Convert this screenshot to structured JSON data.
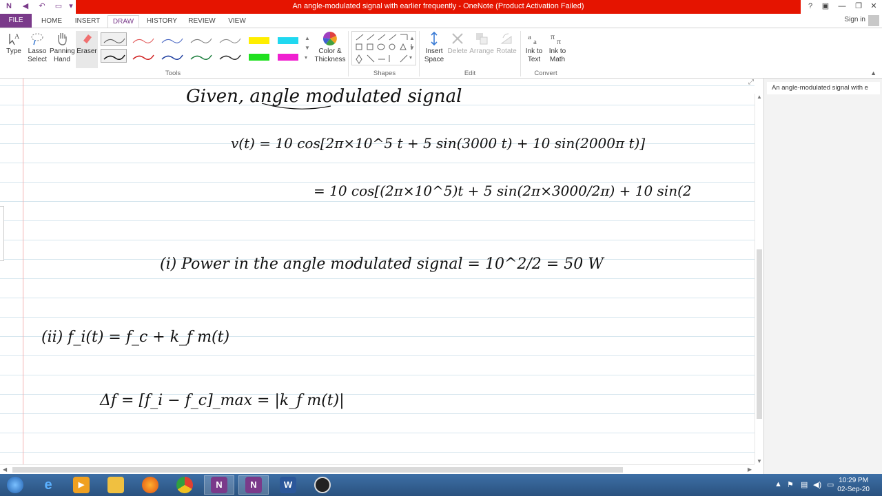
{
  "window": {
    "title": "An angle-modulated signal with earlier frequently  - OneNote (Product Activation Failed)",
    "sign_in": "Sign in",
    "title_color": "#e51400"
  },
  "tabs": [
    {
      "label": "FILE"
    },
    {
      "label": "HOME"
    },
    {
      "label": "INSERT"
    },
    {
      "label": "DRAW",
      "active": true
    },
    {
      "label": "HISTORY"
    },
    {
      "label": "REVIEW"
    },
    {
      "label": "VIEW"
    }
  ],
  "ribbon": {
    "tools": {
      "type": "Type",
      "lasso": "Lasso Select",
      "lasso_1": "Lasso",
      "lasso_2": "Select",
      "panning_1": "Panning",
      "panning_2": "Hand",
      "eraser": "Eraser",
      "color_1": "Color &",
      "color_2": "Thickness",
      "group": "Tools"
    },
    "shapes": {
      "group": "Shapes"
    },
    "edit": {
      "insert_space_1": "Insert",
      "insert_space_2": "Space",
      "delete": "Delete",
      "arrange": "Arrange",
      "rotate": "Rotate",
      "group": "Edit"
    },
    "convert": {
      "ink_text_1": "Ink to",
      "ink_text_2": "Text",
      "ink_math_1": "Ink to",
      "ink_math_2": "Math",
      "group": "Convert"
    }
  },
  "pages": {
    "items": [
      {
        "label": "An angle-modulated signal with e"
      }
    ]
  },
  "notes": {
    "line1": "Given, angle modulated signal",
    "line2": "v(t) = 10 cos[2π×10^5 t + 5 sin(3000 t) + 10 sin(2000π t)]",
    "line3": "= 10 cos[(2π×10^5)t + 5 sin(2π×3000/2π) + 10 sin(2",
    "line4": "(i) Power in the angle modulated signal = 10^2/2 = 50 W",
    "line5": "(ii) f_i(t) = f_c + k_f m(t)",
    "line6": "Δf = [f_i − f_c]_max = |k_f m(t)|"
  },
  "taskbar": {
    "time": "10:29 PM",
    "date": "02-Sep-20",
    "items": [
      {
        "name": "start",
        "label": ""
      },
      {
        "name": "ie",
        "label": "e"
      },
      {
        "name": "media",
        "label": "▶"
      },
      {
        "name": "explorer",
        "label": ""
      },
      {
        "name": "firefox",
        "label": ""
      },
      {
        "name": "chrome",
        "label": ""
      },
      {
        "name": "onenote",
        "label": "N"
      },
      {
        "name": "onenote2",
        "label": "N"
      },
      {
        "name": "word",
        "label": "W"
      },
      {
        "name": "obs",
        "label": ""
      }
    ]
  }
}
